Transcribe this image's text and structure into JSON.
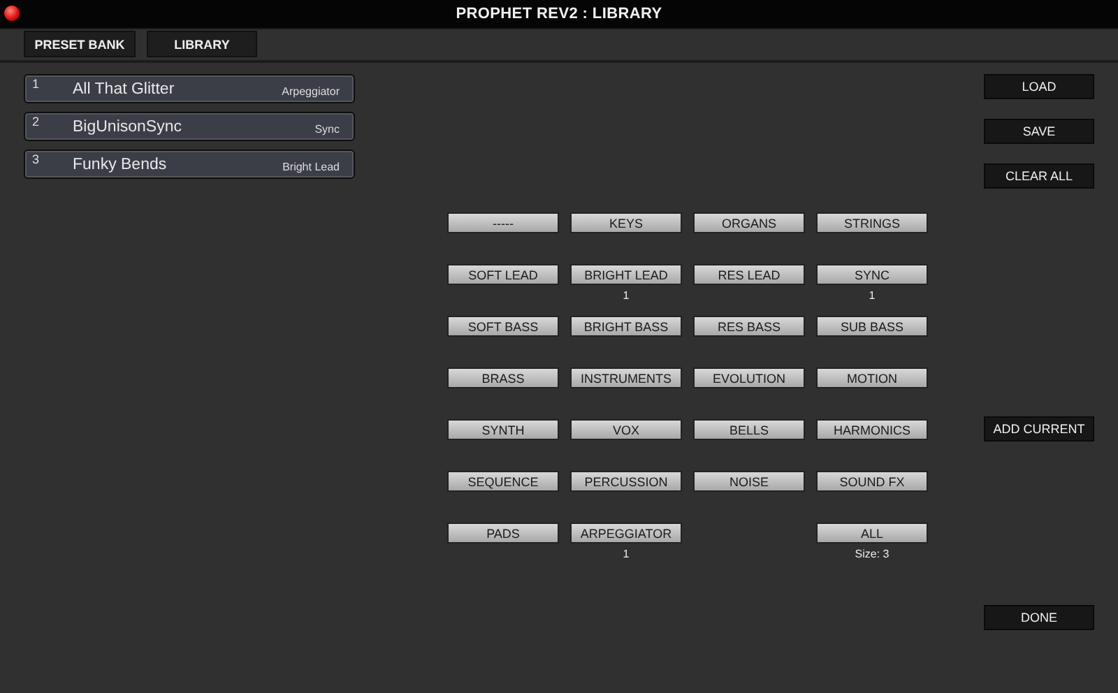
{
  "window": {
    "title": "PROPHET REV2 : LIBRARY"
  },
  "tabs": [
    {
      "label": "PRESET BANK"
    },
    {
      "label": "LIBRARY"
    }
  ],
  "presets": [
    {
      "number": "1",
      "name": "All That Glitter",
      "category": "Arpeggiator"
    },
    {
      "number": "2",
      "name": "BigUnisonSync",
      "category": "Sync"
    },
    {
      "number": "3",
      "name": "Funky Bends",
      "category": "Bright Lead"
    }
  ],
  "categories": [
    {
      "kind": "button",
      "label": "-----"
    },
    {
      "kind": "button",
      "label": "KEYS"
    },
    {
      "kind": "button",
      "label": "ORGANS"
    },
    {
      "kind": "button",
      "label": "STRINGS"
    },
    {
      "kind": "button",
      "label": "SOFT LEAD"
    },
    {
      "kind": "button",
      "label": "BRIGHT LEAD",
      "count": "1"
    },
    {
      "kind": "button",
      "label": "RES LEAD"
    },
    {
      "kind": "button",
      "label": "SYNC",
      "count": "1"
    },
    {
      "kind": "button",
      "label": "SOFT BASS"
    },
    {
      "kind": "button",
      "label": "BRIGHT BASS"
    },
    {
      "kind": "button",
      "label": "RES BASS"
    },
    {
      "kind": "button",
      "label": "SUB BASS"
    },
    {
      "kind": "button",
      "label": "BRASS"
    },
    {
      "kind": "button",
      "label": "INSTRUMENTS"
    },
    {
      "kind": "button",
      "label": "EVOLUTION"
    },
    {
      "kind": "button",
      "label": "MOTION"
    },
    {
      "kind": "button",
      "label": "SYNTH"
    },
    {
      "kind": "button",
      "label": "VOX"
    },
    {
      "kind": "button",
      "label": "BELLS"
    },
    {
      "kind": "button",
      "label": "HARMONICS"
    },
    {
      "kind": "button",
      "label": "SEQUENCE"
    },
    {
      "kind": "button",
      "label": "PERCUSSION"
    },
    {
      "kind": "button",
      "label": "NOISE"
    },
    {
      "kind": "button",
      "label": "SOUND FX"
    },
    {
      "kind": "button",
      "label": "PADS"
    },
    {
      "kind": "button",
      "label": "ARPEGGIATOR",
      "count": "1"
    },
    {
      "kind": "empty"
    },
    {
      "kind": "button",
      "label": "ALL",
      "count": "Size: 3"
    }
  ],
  "actions": [
    "LOAD",
    "SAVE",
    "CLEAR ALL"
  ],
  "add_button": "ADD CURRENT",
  "done_button": "DONE"
}
